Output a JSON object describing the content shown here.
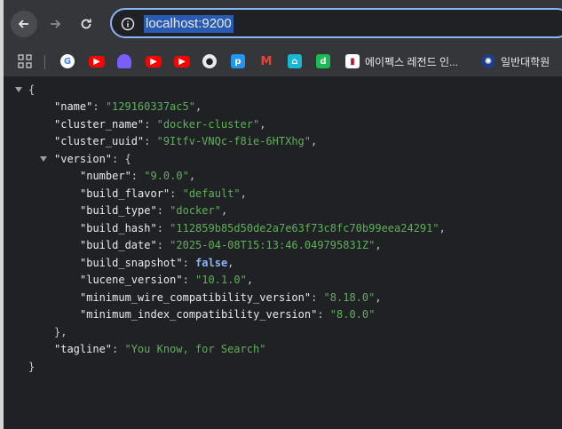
{
  "browser": {
    "url": "localhost:9200",
    "bookmarks": [
      {
        "label": "",
        "icon": "google-icon"
      },
      {
        "label": "",
        "icon": "youtube-icon"
      },
      {
        "label": "",
        "icon": "purple-app-icon"
      },
      {
        "label": "",
        "icon": "youtube-icon"
      },
      {
        "label": "",
        "icon": "youtube-icon"
      },
      {
        "label": "",
        "icon": "github-icon"
      },
      {
        "label": "",
        "icon": "p-app-icon"
      },
      {
        "label": "",
        "icon": "gmail-icon"
      },
      {
        "label": "",
        "icon": "cyan-app-icon"
      },
      {
        "label": "",
        "icon": "d-app-icon"
      },
      {
        "label": "에이펙스 레전드 인...",
        "icon": "apex-icon"
      },
      {
        "label": "일반대학원",
        "icon": "university-icon"
      }
    ]
  },
  "json": {
    "open_brace": "{",
    "close_brace": "}",
    "name_key": "\"name\"",
    "name_val": "\"129160337ac5\"",
    "cluster_name_key": "\"cluster_name\"",
    "cluster_name_val": "\"docker-cluster\"",
    "cluster_uuid_key": "\"cluster_uuid\"",
    "cluster_uuid_val": "\"9Itfv-VNQc-f8ie-6HTXhg\"",
    "version_key": "\"version\"",
    "version_open": "{",
    "version_close": "},",
    "number_key": "\"number\"",
    "number_val": "\"9.0.0\"",
    "build_flavor_key": "\"build_flavor\"",
    "build_flavor_val": "\"default\"",
    "build_type_key": "\"build_type\"",
    "build_type_val": "\"docker\"",
    "build_hash_key": "\"build_hash\"",
    "build_hash_val": "\"112859b85d50de2a7e63f73c8fc70b99eea24291\"",
    "build_date_key": "\"build_date\"",
    "build_date_val": "\"2025-04-08T15:13:46.049795831Z\"",
    "build_snapshot_key": "\"build_snapshot\"",
    "build_snapshot_val": "false",
    "lucene_version_key": "\"lucene_version\"",
    "lucene_version_val": "\"10.1.0\"",
    "min_wire_key": "\"minimum_wire_compatibility_version\"",
    "min_wire_val": "\"8.18.0\"",
    "min_index_key": "\"minimum_index_compatibility_version\"",
    "min_index_val": "\"8.0.0\"",
    "tagline_key": "\"tagline\"",
    "tagline_val": "\"You Know, for Search\""
  },
  "colors": {
    "string": "#5fb05a",
    "key": "#e8eaed",
    "boolean": "#8ab4f8",
    "background": "#202124"
  }
}
